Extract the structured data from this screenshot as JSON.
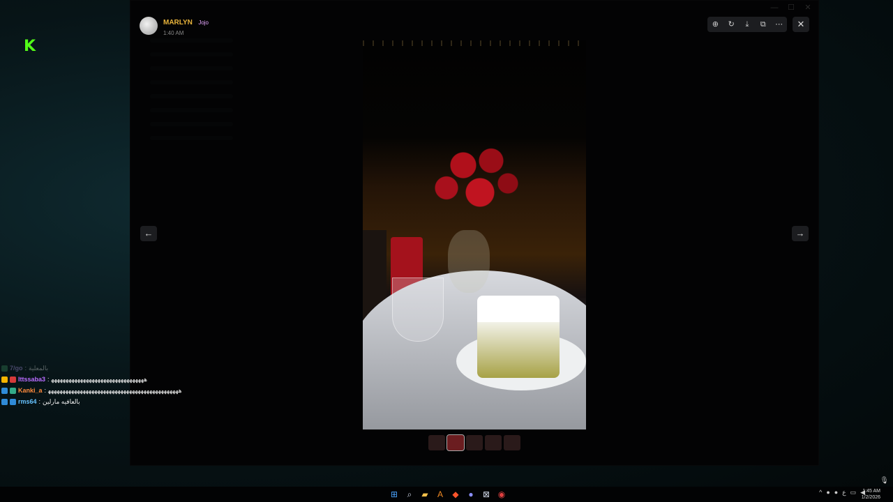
{
  "viewer": {
    "author_name": "MARLYN",
    "author_tag": "Jojo",
    "timestamp": "1:40 AM",
    "toolbar_icons": [
      "zoom-in-icon",
      "rotate-icon",
      "download-icon",
      "open-external-icon",
      "more-icon"
    ],
    "close_label": "✕",
    "prev_label": "←",
    "next_label": "→",
    "thumbnail_count": 5
  },
  "chat": {
    "messages": [
      {
        "user": "7/go",
        "text": "بالمعلية",
        "color": "#bfa6ff",
        "faded": true
      },
      {
        "user": "lttssaba3",
        "text": "ﻫﻬﻬﻬﻬﻬﻬﻬﻬﻬﻬﻬﻬﻬﻬﻬﻬﻬﻬﻬﻬﻬﻬﻬﻬﻬﻬﻬﻬﻬﻬﻬﻬ",
        "color": "#b96cff",
        "faded": false
      },
      {
        "user": "Kanki_a",
        "text": "ﻫﻬﻬﻬﻬﻬﻬﻬﻬﻬﻬﻬﻬﻬﻬﻬﻬﻬﻬﻬﻬﻬﻬﻬﻬﻬﻬﻬﻬﻬﻬﻬﻬﻬﻬﻬﻬﻬﻬﻬﻬﻬﻬﻬﻬﻬ",
        "color": "#ff8a3d",
        "faded": false
      },
      {
        "user": "rms64",
        "text": "بالعافيه مارلين",
        "color": "#66c2ff",
        "faded": false
      }
    ]
  },
  "taskbar": {
    "clock_time": "1:45 AM",
    "clock_date": "1/2/2026",
    "tray_lang": "ع"
  },
  "colors": {
    "kick_green": "#53fc18",
    "author_gold": "#e8b33b",
    "toolbar_bg": "#1c1d20"
  }
}
